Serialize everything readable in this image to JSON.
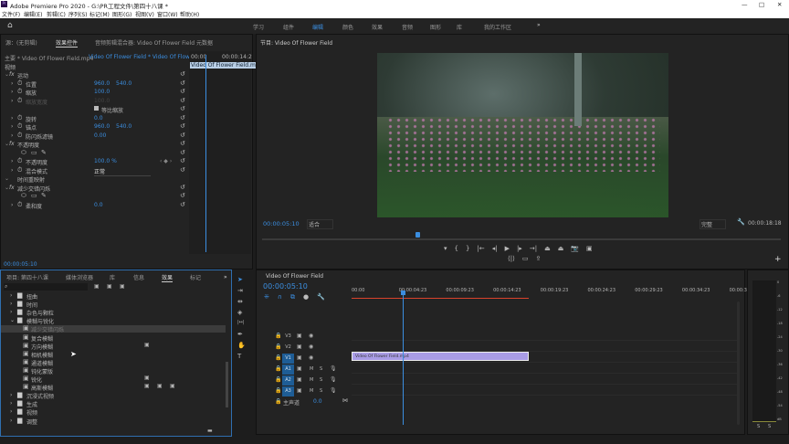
{
  "app": {
    "title": "Adobe Premiere Pro 2020 - G:\\PR工程文件\\第四十八课 *",
    "window_controls": [
      "—",
      "□",
      "✕"
    ]
  },
  "menu": [
    "文件(F)",
    "编辑(E)",
    "剪辑(C)",
    "序列(S)",
    "标记(M)",
    "图形(G)",
    "视图(V)",
    "窗口(W)",
    "帮助(H)"
  ],
  "workspaces": {
    "items": [
      "学习",
      "组件",
      "编辑",
      "颜色",
      "效果",
      "音频",
      "图形",
      "库",
      "我的工作区"
    ],
    "active": "编辑",
    "more": "»"
  },
  "effect_controls": {
    "tabs": [
      "源：(无剪辑)",
      "效果控件",
      "音频剪辑混合器: Video Of Flower Field",
      "元数据"
    ],
    "master": "主要 * Video Of Flower Field.mp4",
    "sequence_clip": "Video Of Flower Field * Video Of Flower F...",
    "mini_start": "00:00",
    "mini_end": "00:00:14:2",
    "mini_clip": "Video Of Flower Field.mp4",
    "section": "视频",
    "rows": [
      {
        "label": "运动",
        "fx": true
      },
      {
        "label": "位置",
        "v1": "960.0",
        "v2": "540.0"
      },
      {
        "label": "缩放",
        "v1": "100.0"
      },
      {
        "label": "缩放宽度",
        "v1": "100.0",
        "dim": true
      },
      {
        "label": "",
        "check": "等比缩放"
      },
      {
        "label": "旋转",
        "v1": "0.0"
      },
      {
        "label": "锚点",
        "v1": "960.0",
        "v2": "540.0"
      },
      {
        "label": "防闪烁滤镜",
        "v1": "0.00"
      },
      {
        "label": "不透明度",
        "fx": true
      },
      {
        "label": "",
        "masks": true
      },
      {
        "label": "不透明度",
        "v1": "100.0 %",
        "kf": true
      },
      {
        "label": "混合模式",
        "select": "正常"
      },
      {
        "label": "时间重映射",
        "fx": true,
        "nofx": true
      },
      {
        "label": "减少交错闪烁",
        "fx": true
      },
      {
        "label": "",
        "masks": true
      },
      {
        "label": "柔和度",
        "v1": "0.0"
      }
    ],
    "timecode": "00:00:05:10"
  },
  "project": {
    "tabs": [
      "项目: 第四十八课",
      "媒体浏览器",
      "库",
      "信息",
      "效果",
      "标记"
    ],
    "active_tab": "效果",
    "tree": [
      {
        "label": "扭曲",
        "type": "folder"
      },
      {
        "label": "时间",
        "type": "folder"
      },
      {
        "label": "杂色与颗粒",
        "type": "folder"
      },
      {
        "label": "模糊与锐化",
        "type": "folder",
        "open": true
      },
      {
        "label": "减少交错闪烁",
        "type": "fx",
        "selected": true
      },
      {
        "label": "复合模糊",
        "type": "fx"
      },
      {
        "label": "方向模糊",
        "type": "fx",
        "badges": 1
      },
      {
        "label": "相机模糊",
        "type": "fx"
      },
      {
        "label": "通道模糊",
        "type": "fx"
      },
      {
        "label": "钝化蒙版",
        "type": "fx"
      },
      {
        "label": "锐化",
        "type": "fx",
        "badges": 1
      },
      {
        "label": "高斯模糊",
        "type": "fx",
        "badges": 3
      },
      {
        "label": "沉浸式视频",
        "type": "folder"
      },
      {
        "label": "生成",
        "type": "folder"
      },
      {
        "label": "视频",
        "type": "folder"
      },
      {
        "label": "调整",
        "type": "folder"
      }
    ]
  },
  "program": {
    "tab": "节目: Video Of Flower Field",
    "timecode": "00:00:05:10",
    "fit": "适合",
    "quality": "完整",
    "duration": "00:00:18:18",
    "playhead_fraction": 0.3
  },
  "timeline": {
    "tab": "Video Of Flower Field",
    "timecode": "00:00:05:10",
    "ruler": [
      "00:00",
      "00:00:04:23",
      "00:00:09:23",
      "00:00:14:23",
      "00:00:19:23",
      "00:00:24:23",
      "00:00:29:23",
      "00:00:34:23",
      "00:00:3"
    ],
    "tracks": [
      {
        "id": "V3"
      },
      {
        "id": "V2"
      },
      {
        "id": "V1",
        "target": true
      },
      {
        "id": "A1",
        "target": true,
        "audio": true
      },
      {
        "id": "A2",
        "target": true,
        "audio": true
      },
      {
        "id": "A3",
        "target": true,
        "audio": true
      }
    ],
    "master": {
      "label": "主声道",
      "value": "0.0"
    },
    "clip": "Video Of Flower Field.mp4"
  },
  "meter": {
    "scale": [
      "0",
      "-6",
      "-12",
      "-18",
      "-24",
      "-30",
      "-36",
      "-42",
      "-48",
      "-54",
      "dB"
    ],
    "solo": [
      "S",
      "S"
    ]
  },
  "colors": {
    "accent": "#3b8ee0",
    "clip": "#a99ce6",
    "in_out": "#d9432b"
  }
}
